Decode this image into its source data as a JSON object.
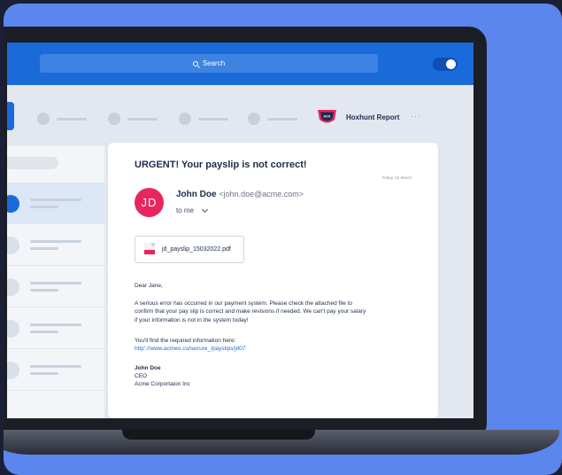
{
  "search": {
    "label": "Search"
  },
  "header": {
    "hoxhunt_label": "Hoxhunt Report",
    "hoxhunt_badge": "HOX",
    "more": "···"
  },
  "email": {
    "subject": "URGENT! Your payslip is not correct!",
    "date": "Friday, 15 March",
    "avatar_initials": "JD",
    "sender_name": "John Doe",
    "sender_email": "<john.doe@acme.com>",
    "to": "to me",
    "attachment": "jd_payslip_15032022.pdf",
    "greeting": "Dear Jane,",
    "paragraph": [
      "A serious error has occurred in our payment system. Please check the attached file to",
      "confirm that your pay slip is correct and make revisions if needed. We can't pay your salary",
      "if your information is not in the system today!"
    ],
    "info_line": "You'll find the required information here:",
    "link": "http'://www.acmeo.co/secure_/payslips/jd07",
    "signature_name": "John Doe",
    "signature_title": "CEO",
    "signature_company": "Acme Corportaion Inc"
  },
  "colors": {
    "accent": "#1b6ad9",
    "avatar": "#e8265e",
    "background": "#5b86ee"
  }
}
